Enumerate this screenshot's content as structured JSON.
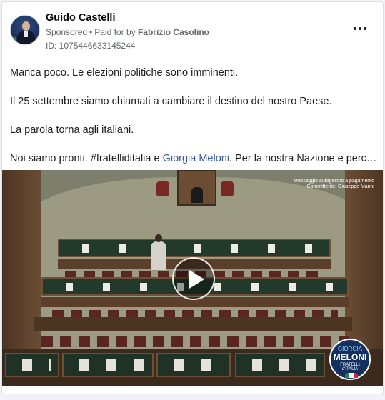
{
  "ad": {
    "page_name": "Guido Castelli",
    "sponsored_label": "Sponsored",
    "separator": "•",
    "paid_for_prefix": "Paid for by",
    "paid_for_name": "Fabrizio Casolino",
    "ad_id_label": "ID: 1075446633145244",
    "more_options_icon": "more-horizontal-icon"
  },
  "body": {
    "line1": "Manca poco. Le elezioni politiche sono imminenti.",
    "line2": "Il 25 settembre siamo chiamati a cambiare il destino del nostro Paese.",
    "line3": "La parola torna agli italiani.",
    "line4_prefix": "Noi siamo pronti. #fratelliditalia e ",
    "line4_link": "Giorgia Meloni",
    "line4_suffix": ". Per la nostra Nazione e perché l..."
  },
  "video": {
    "caption_line1": "Messaggio autogestito a pagamento",
    "caption_line2": "Committente: Giuseppe Marini",
    "play_icon": "play-icon",
    "logo_line1": "GIORGIA",
    "logo_line2": "MELONI",
    "logo_line3a": "FRATELLI",
    "logo_line3b": "d'ITALIA"
  },
  "colors": {
    "link": "#385898",
    "meta_text": "#65676b",
    "logo_blue": "#13305f"
  }
}
